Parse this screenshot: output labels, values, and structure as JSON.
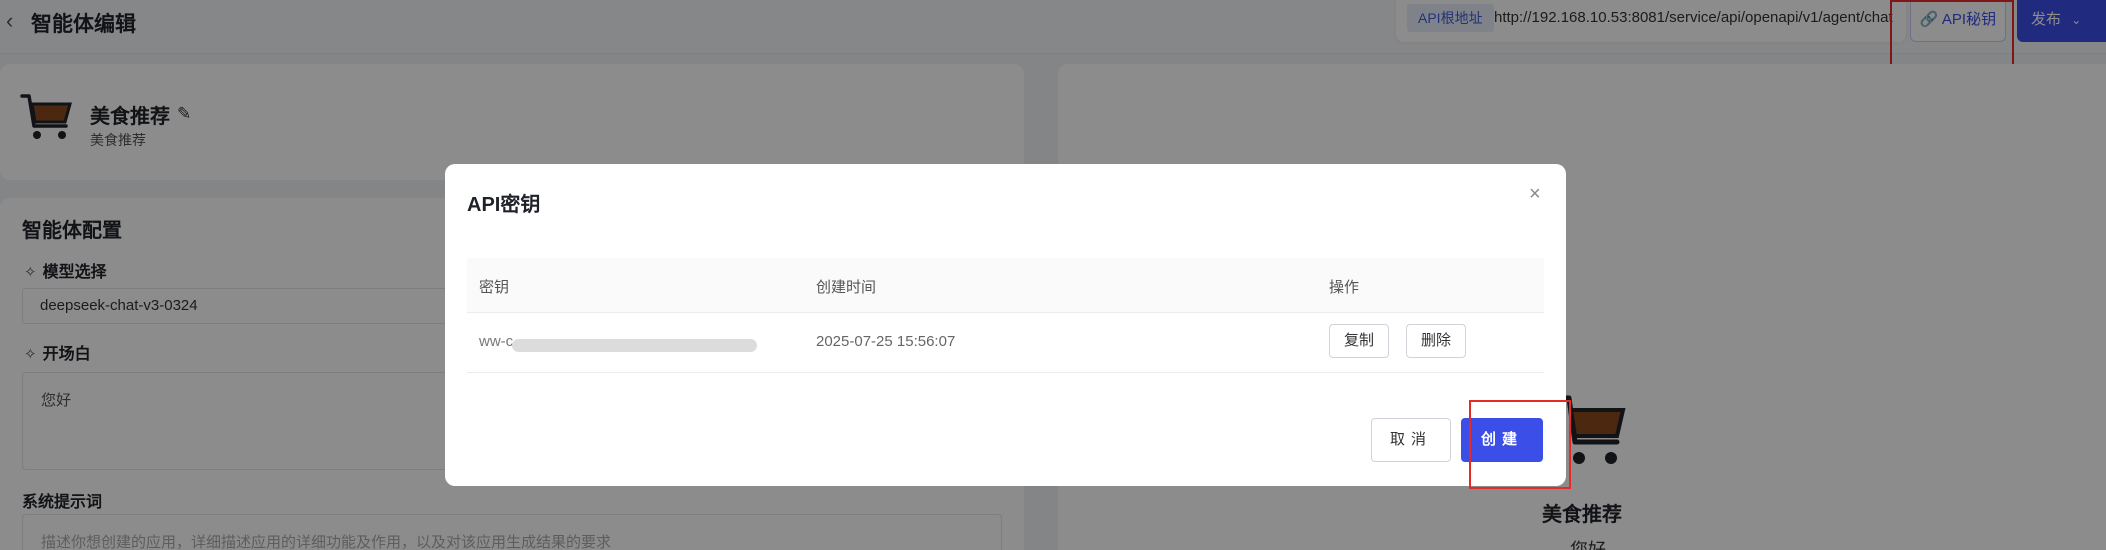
{
  "header": {
    "back_icon": "chevron-left-icon",
    "title": "智能体编辑"
  },
  "api_bar": {
    "tag": "API根地址",
    "url": "http://192.168.10.53:8081/service/api/openapi/v1/agent/chat",
    "key_button": "API秘钥",
    "key_button_icon": "link-icon",
    "publish_button": "发布",
    "publish_icon": "chevron-down-icon"
  },
  "agent": {
    "name": "美食推荐",
    "description": "美食推荐",
    "avatar_icon": "shopping-cart-icon"
  },
  "config": {
    "title": "智能体配置",
    "model_label": "模型选择",
    "model_value": "deepseek-chat-v3-0324",
    "greeting_label": "开场白",
    "greeting_value": "您好",
    "system_prompt_label": "系统提示词",
    "system_prompt_placeholder": "描述你想创建的应用，详细描述应用的详细功能及作用，以及对该应用生成结果的要求"
  },
  "preview": {
    "name": "美食推荐",
    "sub": "您好"
  },
  "modal": {
    "title": "API密钥",
    "close_icon": "close-icon",
    "columns": [
      "密钥",
      "创建时间",
      "操作"
    ],
    "rows": [
      {
        "key": "ww-c",
        "created": "2025-07-25 15:56:07",
        "copy": "复制",
        "delete": "删除"
      }
    ],
    "cancel_button": "取消",
    "create_button": "创建"
  },
  "colors": {
    "primary": "#3b4ee8",
    "highlight": "#e52a2a",
    "overlay": "rgba(0,0,0,0.45)"
  }
}
